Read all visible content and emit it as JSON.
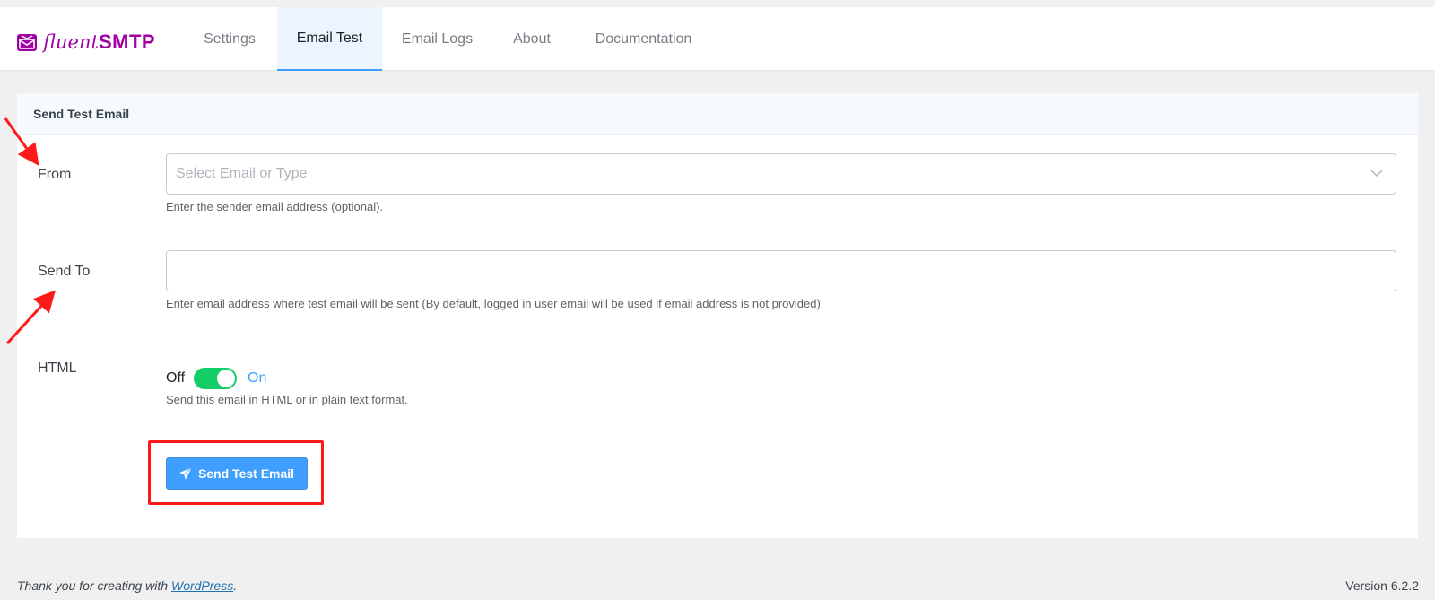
{
  "brand": {
    "name_light": "fluent",
    "name_bold": "SMTP",
    "color": "#a100a5"
  },
  "nav": {
    "tabs": [
      {
        "label": "Settings",
        "active": false
      },
      {
        "label": "Email Test",
        "active": true
      },
      {
        "label": "Email Logs",
        "active": false
      },
      {
        "label": "About",
        "active": false
      },
      {
        "label": "Documentation",
        "active": false
      }
    ]
  },
  "card": {
    "title": "Send Test Email",
    "from": {
      "label": "From",
      "placeholder": "Select Email or Type",
      "help": "Enter the sender email address (optional).",
      "icon": "chevron-down-icon"
    },
    "send_to": {
      "label": "Send To",
      "value": "",
      "help": "Enter email address where test email will be sent (By default, logged in user email will be used if email address is not provided)."
    },
    "html": {
      "label": "HTML",
      "off_label": "Off",
      "on_label": "On",
      "enabled": true,
      "help": "Send this email in HTML or in plain text format."
    },
    "submit": {
      "label": "Send Test Email",
      "icon": "paper-plane-icon",
      "color": "#409eff"
    }
  },
  "footer": {
    "thanks_prefix": "Thank you for creating with ",
    "thanks_link": "WordPress",
    "thanks_suffix": ".",
    "version": "Version 6.2.2"
  },
  "annotations": {
    "arrow_color": "#ff1a1a",
    "highlight_color": "#ff1a1a"
  }
}
